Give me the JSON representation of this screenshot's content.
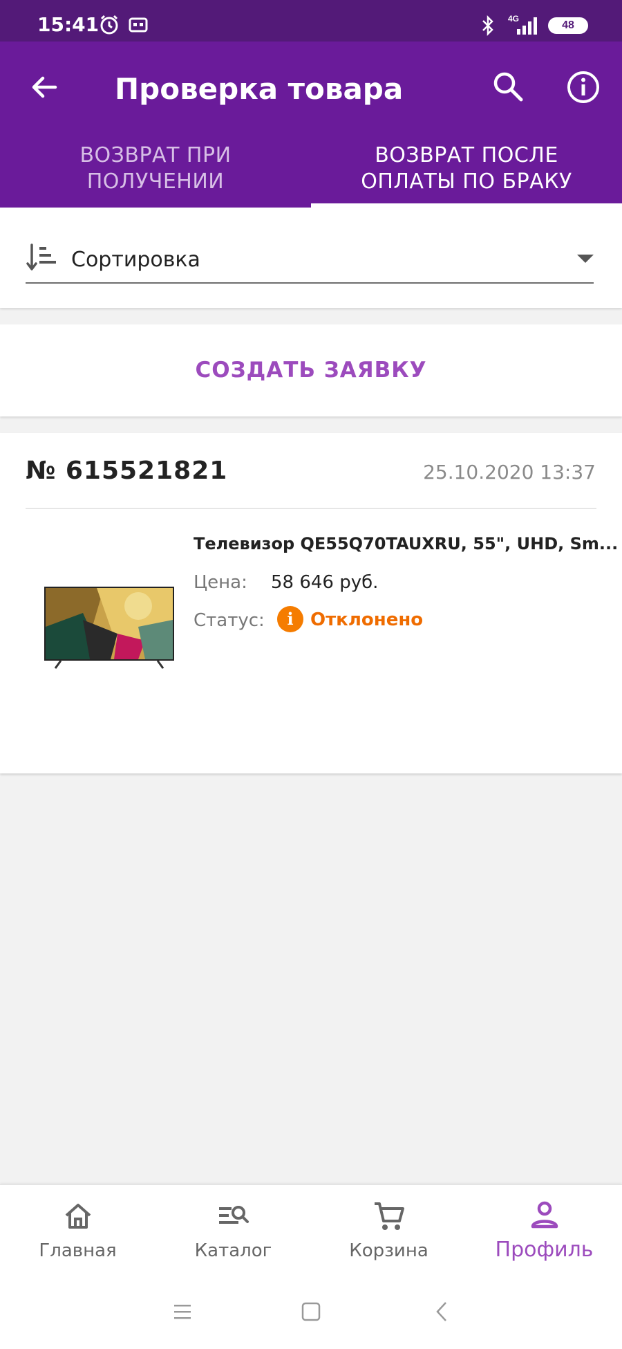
{
  "status_bar": {
    "time": "15:41",
    "network": "4G",
    "battery": "48",
    "icons": [
      "alarm-icon",
      "cast-icon",
      "bluetooth-icon",
      "signal-icon",
      "battery-icon"
    ]
  },
  "app_bar": {
    "title": "Проверка товара",
    "icons": [
      "back-arrow-icon",
      "search-icon",
      "info-icon"
    ],
    "background": "#6a1b9a"
  },
  "tabs": [
    {
      "label": "ВОЗВРАТ ПРИ ПОЛУЧЕНИИ",
      "line1": "ВОЗВРАТ ПРИ",
      "line2": "ПОЛУЧЕНИИ",
      "active": false
    },
    {
      "label": "ВОЗВРАТ ПОСЛЕ ОПЛАТЫ ПО БРАКУ",
      "line1": "ВОЗВРАТ ПОСЛЕ",
      "line2": "ОПЛАТЫ ПО БРАКУ",
      "active": true
    }
  ],
  "sort": {
    "label": "Сортировка",
    "icon": "sort-icon"
  },
  "create_request": {
    "label": "СОЗДАТЬ ЗАЯВКУ"
  },
  "order": {
    "number": "№ 615521821",
    "date": "25.10.2020 13:37",
    "product_name": "Телевизор QE55Q70TAUXRU, 55\", UHD, Sm...",
    "price_label": "Цена:",
    "price_value": "58 646 руб.",
    "status_label": "Статус:",
    "status_value": "Отклонено",
    "status_color": "#ef6c00"
  },
  "bottom_nav": [
    {
      "label": "Главная",
      "icon": "home-icon",
      "active": false
    },
    {
      "label": "Каталог",
      "icon": "catalog-search-icon",
      "active": false
    },
    {
      "label": "Корзина",
      "icon": "cart-icon",
      "active": false
    },
    {
      "label": "Профиль",
      "icon": "profile-icon",
      "active": true
    }
  ],
  "accent_color": "#9c4bbd"
}
